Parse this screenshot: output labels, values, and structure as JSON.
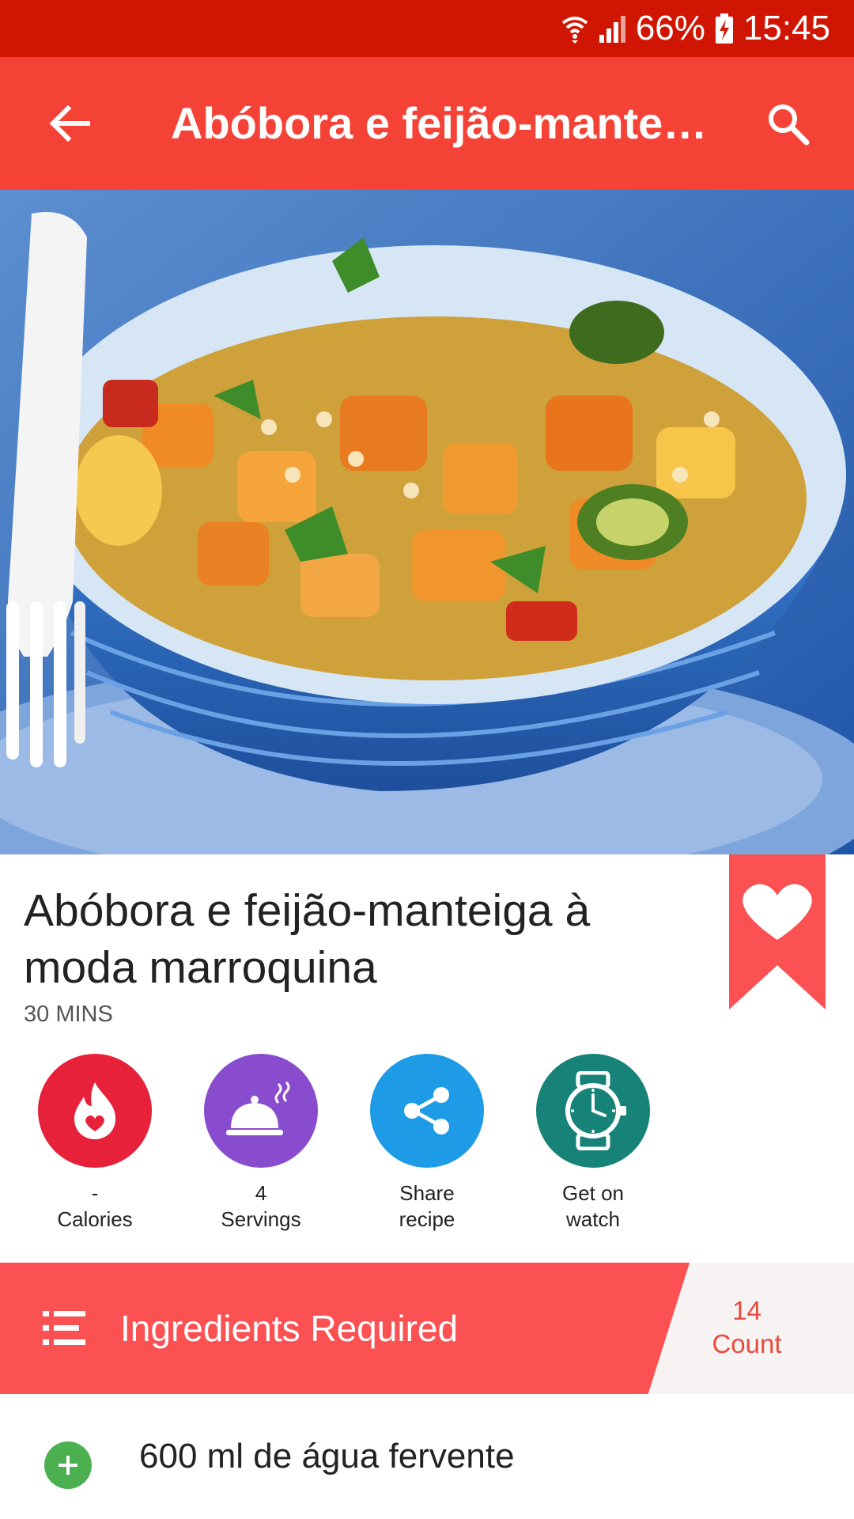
{
  "status_bar": {
    "battery": "66%",
    "time": "15:45"
  },
  "app_bar": {
    "title": "Abóbora e feijão-manteiga à moda marroquina"
  },
  "recipe": {
    "title": "Abóbora e feijão-manteiga à moda marroquina",
    "duration": "30 MINS"
  },
  "actions": [
    {
      "line1": "-",
      "line2": "Calories",
      "icon": "calories-flame-icon",
      "color": "#e8213b"
    },
    {
      "line1": "4",
      "line2": "Servings",
      "icon": "cloche-icon",
      "color": "#8a4ccf"
    },
    {
      "line1": "Share",
      "line2": "recipe",
      "icon": "share-icon",
      "color": "#1e9be6"
    },
    {
      "line1": "Get on",
      "line2": "watch",
      "icon": "watch-icon",
      "color": "#178378"
    }
  ],
  "ingredients": {
    "header_label": "Ingredients Required",
    "count_value": "14",
    "count_label": "Count",
    "items": [
      "600 ml de água fervente"
    ]
  },
  "colors": {
    "status_bar": "#d01602",
    "app_bar": "#f44336",
    "accent": "#fb5152",
    "add_green": "#4caf50"
  }
}
